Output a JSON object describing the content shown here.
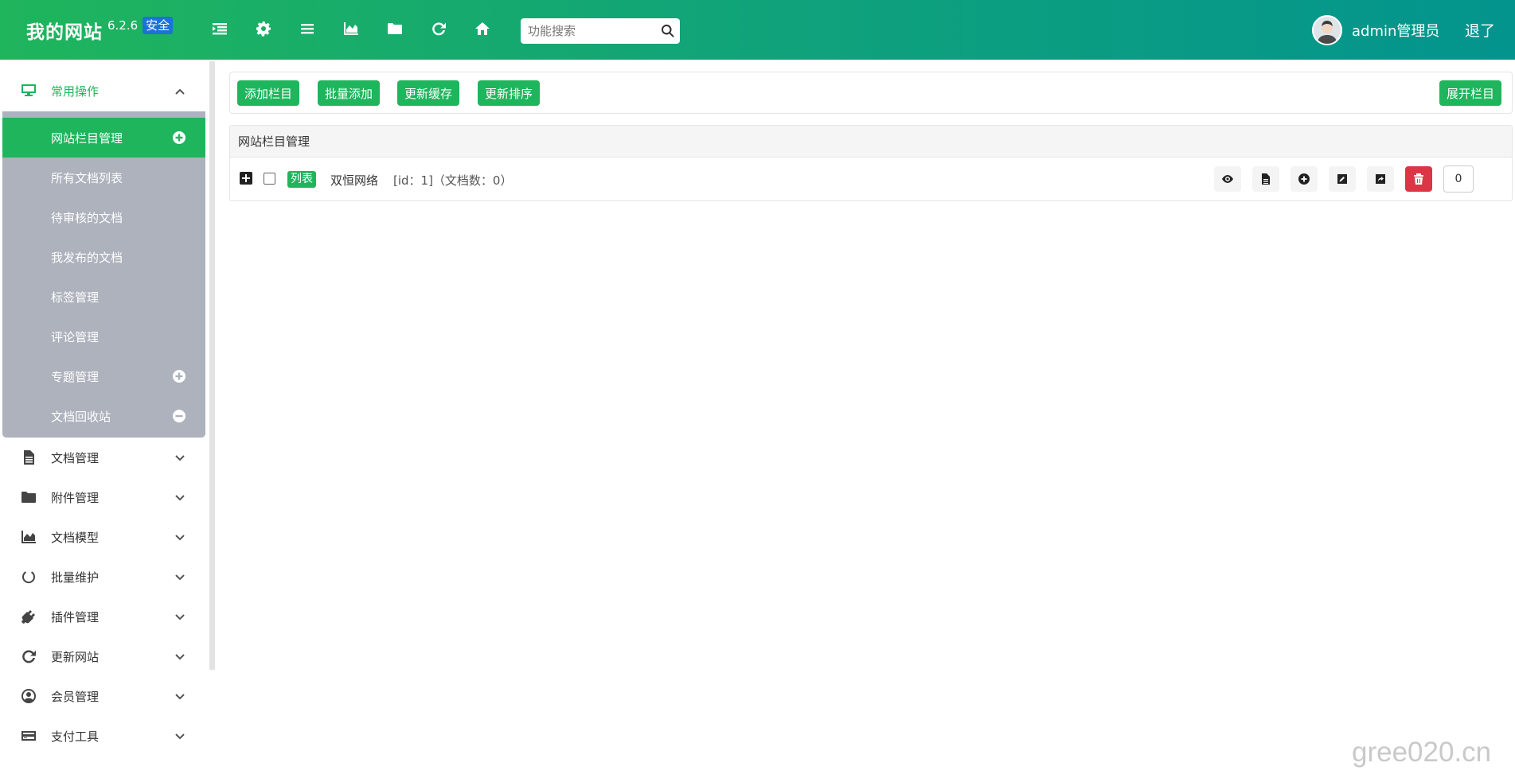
{
  "header": {
    "brand_name": "我的网站",
    "version": "6.2.6",
    "badge": "安全",
    "toolbar": [
      "menu-toggle-icon",
      "gear-icon",
      "list-icon",
      "area-chart-icon",
      "folder-icon",
      "refresh-icon",
      "home-icon"
    ],
    "search_placeholder": "功能搜索",
    "username": "admin管理员",
    "logout": "退了"
  },
  "sidebar": {
    "open_group": {
      "label": "常用操作",
      "icon": "desktop-icon"
    },
    "sub_items": [
      {
        "label": "网站栏目管理",
        "active": true,
        "action": "plus-circle-icon"
      },
      {
        "label": "所有文档列表"
      },
      {
        "label": "待审核的文档"
      },
      {
        "label": "我发布的文档"
      },
      {
        "label": "标签管理"
      },
      {
        "label": "评论管理"
      },
      {
        "label": "专题管理",
        "action": "plus-circle-icon"
      },
      {
        "label": "文档回收站",
        "action": "minus-circle-icon"
      }
    ],
    "groups": [
      {
        "label": "文档管理",
        "icon": "file-text-icon"
      },
      {
        "label": "附件管理",
        "icon": "folder-icon"
      },
      {
        "label": "文档模型",
        "icon": "area-chart-icon"
      },
      {
        "label": "批量维护",
        "icon": "circle-notch-icon"
      },
      {
        "label": "插件管理",
        "icon": "plug-icon"
      },
      {
        "label": "更新网站",
        "icon": "refresh-icon"
      },
      {
        "label": "会员管理",
        "icon": "user-circle-icon"
      },
      {
        "label": "支付工具",
        "icon": "credit-card-icon"
      }
    ]
  },
  "actions": {
    "add_column": "添加栏目",
    "batch_add": "批量添加",
    "update_cache": "更新缓存",
    "update_sort": "更新排序",
    "expand_columns": "展开栏目"
  },
  "panel": {
    "title": "网站栏目管理",
    "rows": [
      {
        "type_tag": "列表",
        "name": "双恒网络",
        "meta": "[id：1]（文档数：0）",
        "sort_value": "0"
      }
    ]
  },
  "watermark": "gree020.cn",
  "colors": {
    "brand_green": "#1fb55c",
    "header_teal": "#03948e",
    "danger": "#dc3545",
    "submenu_bg": "#adb2bd"
  }
}
